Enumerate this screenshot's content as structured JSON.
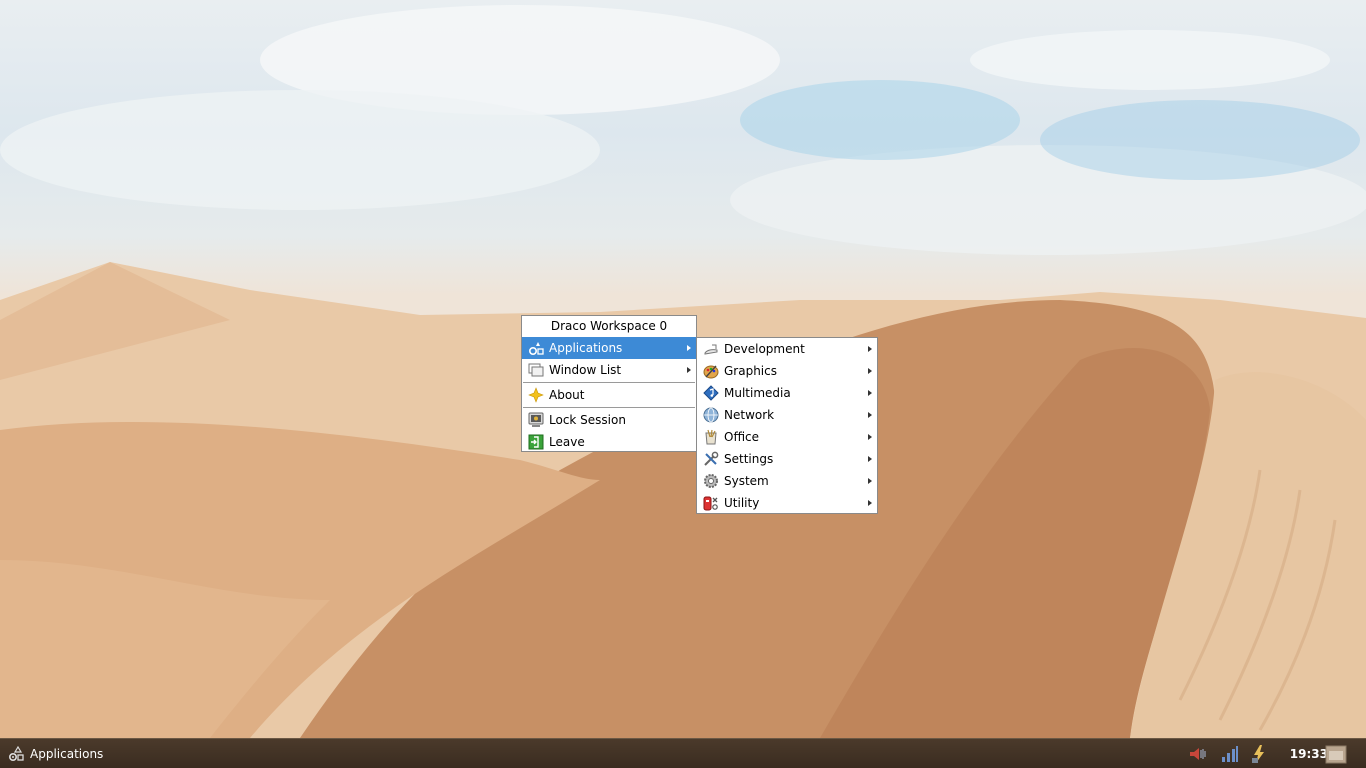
{
  "root_menu": {
    "title": "Draco Workspace 0",
    "items": [
      {
        "label": "Applications",
        "icon": "applications-icon",
        "submenu": true,
        "active": true
      },
      {
        "label": "Window List",
        "icon": "window-list-icon",
        "submenu": true
      },
      {
        "label": "About",
        "icon": "about-star-icon"
      },
      {
        "label": "Lock Session",
        "icon": "lock-session-icon"
      },
      {
        "label": "Leave",
        "icon": "leave-icon"
      }
    ]
  },
  "applications_menu": {
    "items": [
      {
        "label": "Development",
        "icon": "development-icon"
      },
      {
        "label": "Graphics",
        "icon": "graphics-icon"
      },
      {
        "label": "Multimedia",
        "icon": "multimedia-icon"
      },
      {
        "label": "Network",
        "icon": "network-icon"
      },
      {
        "label": "Office",
        "icon": "office-icon"
      },
      {
        "label": "Settings",
        "icon": "settings-icon"
      },
      {
        "label": "System",
        "icon": "system-icon"
      },
      {
        "label": "Utility",
        "icon": "utility-icon"
      }
    ]
  },
  "taskbar": {
    "start_label": "Applications",
    "clock": "19:33",
    "tray_icons": [
      "volume-icon",
      "network-signal-icon",
      "power-icon",
      "show-desktop-icon"
    ]
  },
  "colors": {
    "menu_highlight": "#3d8ad6",
    "taskbar": "#3f3024"
  }
}
